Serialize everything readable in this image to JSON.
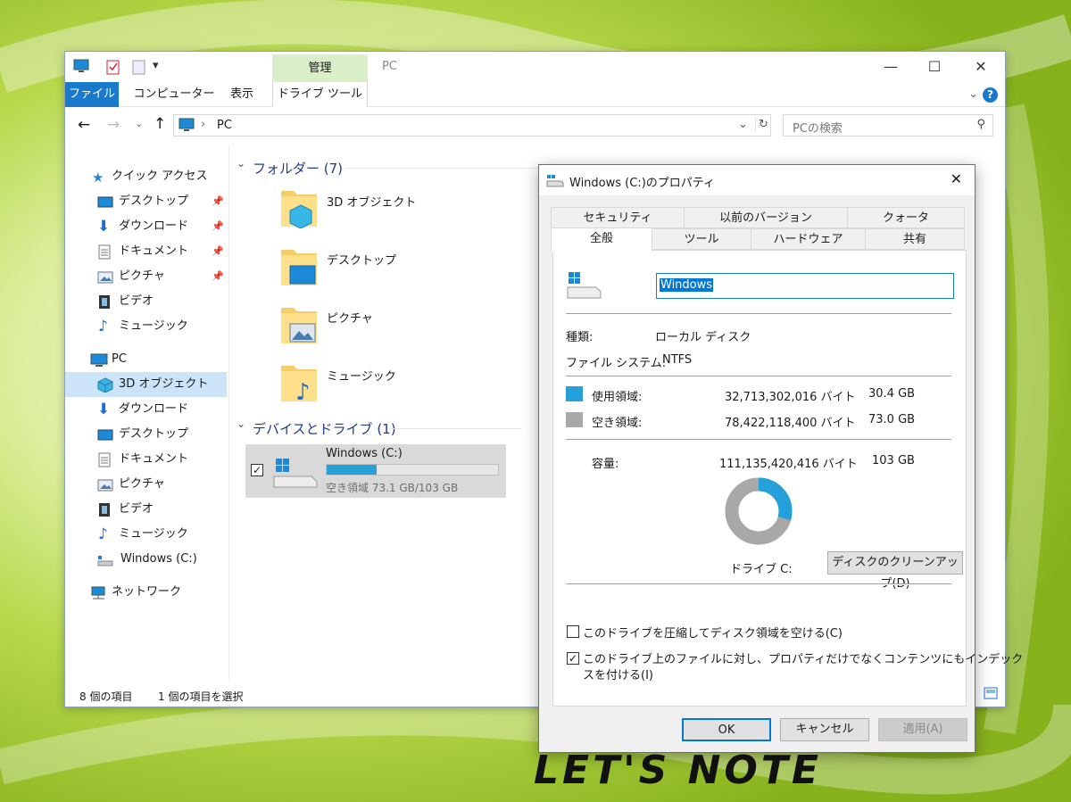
{
  "explorer": {
    "title": "PC",
    "context_tab": "管理",
    "tabs": {
      "file": "ファイル",
      "computer": "コンピューター",
      "view": "表示",
      "drive_tools": "ドライブ ツール"
    },
    "address": "PC",
    "search_placeholder": "PCの検索",
    "sidebar": {
      "quick_access": "クイック アクセス",
      "quick_items": [
        "デスクトップ",
        "ダウンロード",
        "ドキュメント",
        "ピクチャ",
        "ビデオ",
        "ミュージック"
      ],
      "pc": "PC",
      "pc_items": [
        "3D オブジェクト",
        "ダウンロード",
        "デスクトップ",
        "ドキュメント",
        "ピクチャ",
        "ビデオ",
        "ミュージック",
        "Windows (C:)"
      ],
      "network": "ネットワーク"
    },
    "folders_header": "フォルダー (7)",
    "folders": [
      "3D オブジェクト",
      "デスクトップ",
      "ピクチャ",
      "ミュージック"
    ],
    "devices_header": "デバイスとドライブ (1)",
    "drive": {
      "name": "Windows (C:)",
      "free_text": "空き領域 73.1 GB/103 GB",
      "used_fraction": 0.29
    },
    "status": {
      "count": "8 個の項目",
      "selected": "1 個の項目を選択"
    }
  },
  "dialog": {
    "title": "Windows (C:)のプロパティ",
    "tabs_back": [
      "セキュリティ",
      "以前のバージョン",
      "クォータ"
    ],
    "tabs_front": [
      "全般",
      "ツール",
      "ハードウェア",
      "共有"
    ],
    "label_value": "Windows",
    "type_label": "種類:",
    "type_value": "ローカル ディスク",
    "fs_label": "ファイル システム:",
    "fs_value": "NTFS",
    "used_label": "使用領域:",
    "used_bytes": "32,713,302,016 バイト",
    "used_gb": "30.4 GB",
    "free_label": "空き領域:",
    "free_bytes": "78,422,118,400 バイト",
    "free_gb": "73.0 GB",
    "cap_label": "容量:",
    "cap_bytes": "111,135,420,416 バイト",
    "cap_gb": "103 GB",
    "drive_label": "ドライブ C:",
    "cleanup": "ディスクのクリーンアップ(D)",
    "compress": "このドライブを圧縮してディスク領域を空ける(C)",
    "index1": "このドライブ上のファイルに対し、プロパティだけでなくコンテンツにもインデック",
    "index2": "スを付ける(I)",
    "ok": "OK",
    "cancel": "キャンセル",
    "apply": "適用(A)",
    "colors": {
      "used": "#26a0da",
      "free": "#a8a8a8"
    },
    "used_fraction": 0.294
  },
  "logo": "LET'S NOTE"
}
